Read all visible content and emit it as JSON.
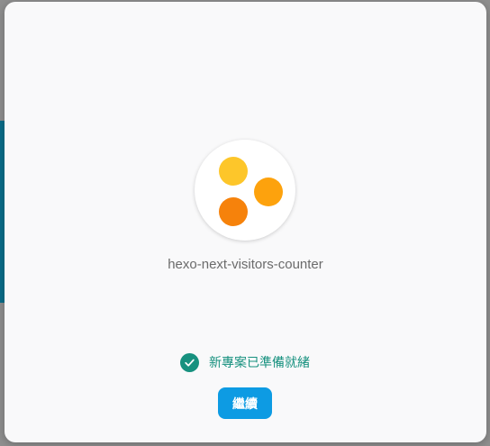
{
  "colors": {
    "dialog_background": "#f9f9fa",
    "success": "#17917f",
    "primary_button": "#0d9be3",
    "logo_dot_yellow": "#fdc62a",
    "logo_dot_orange_light": "#fda20d",
    "logo_dot_orange_dark": "#f6820b"
  },
  "logo": {
    "icon": "firebase-project-logo-icon"
  },
  "project": {
    "name": "hexo-next-visitors-counter"
  },
  "status": {
    "icon": "check-circle-icon",
    "message": "新專案已準備就緒"
  },
  "actions": {
    "continue_label": "繼續"
  }
}
